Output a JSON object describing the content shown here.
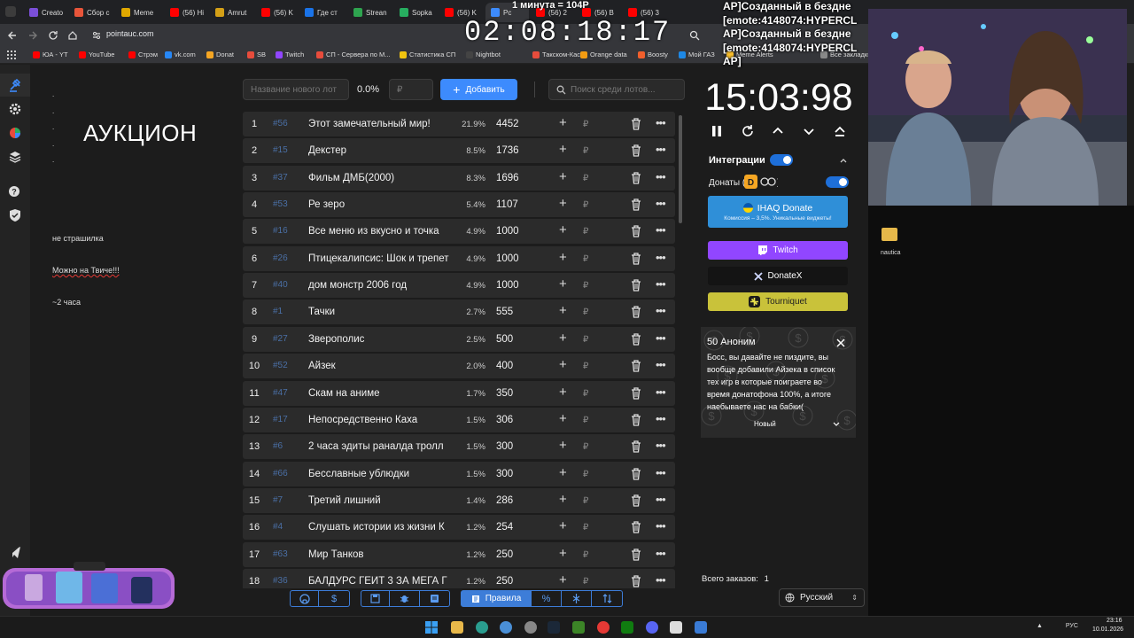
{
  "browser": {
    "tabs": [
      {
        "label": "Creato",
        "color": "#7b4fd8"
      },
      {
        "label": "Сбор с",
        "color": "#e8553a"
      },
      {
        "label": "Meme",
        "color": "#e0a800"
      },
      {
        "label": "(56) Hi",
        "color": "#ff0000"
      },
      {
        "label": "Amrut",
        "color": "#d4a017"
      },
      {
        "label": "(56) K",
        "color": "#ff0000"
      },
      {
        "label": "Где ст",
        "color": "#1a73e8"
      },
      {
        "label": "Strean",
        "color": "#2ea44f"
      },
      {
        "label": "Sopka",
        "color": "#27ae60"
      },
      {
        "label": "(56) K",
        "color": "#ff0000"
      },
      {
        "label": "Рс",
        "color": "#3d8bfd"
      },
      {
        "label": "(56) 2",
        "color": "#ff0000"
      },
      {
        "label": "(56) B",
        "color": "#ff0000"
      },
      {
        "label": "(56) 3",
        "color": "#ff0000"
      }
    ],
    "url": "pointauc.com",
    "bookmarks": [
      {
        "label": "ЮА - YT",
        "color": "#ff0000"
      },
      {
        "label": "YouTube",
        "color": "#ff0000"
      },
      {
        "label": "Стрэм",
        "color": "#ff0000"
      },
      {
        "label": "vk.com",
        "color": "#2787f5"
      },
      {
        "label": "Donat",
        "color": "#f5a623"
      },
      {
        "label": "SB",
        "color": "#e74c3c"
      },
      {
        "label": "Twitch",
        "color": "#9146ff"
      },
      {
        "label": "СП - Сервера по М...",
        "color": "#e74c3c"
      },
      {
        "label": "Статистика СП",
        "color": "#f1c40f"
      },
      {
        "label": "Nightbot",
        "color": "#444"
      },
      {
        "label": "Такском-Касса",
        "color": "#e74c3c"
      },
      {
        "label": "Orange data",
        "color": "#f39c12"
      },
      {
        "label": "Boosty",
        "color": "#f15f2c"
      },
      {
        "label": "Мой ГАЗ",
        "color": "#1e88e5"
      },
      {
        "label": "Meme Alerts",
        "color": "#fbc02d"
      },
      {
        "label": "Все закладки",
        "color": "#888"
      }
    ]
  },
  "sidebar": {
    "title": "АУКЦИОН",
    "bullets": [
      ".",
      ".",
      ".",
      ".",
      ".",
      "."
    ],
    "notes": [
      "не страшилка",
      "Можно на  Твиче!!!",
      "~2 часа"
    ]
  },
  "controls": {
    "new_lot_placeholder": "Название нового лот",
    "percent": "0.0%",
    "amount_placeholder": "₽",
    "add_label": "Добавить",
    "search_placeholder": "Поиск среди лотов..."
  },
  "lots": [
    {
      "num": "1",
      "fast": "#56",
      "name": "Этот замечательный мир!",
      "pct": "21.9%",
      "amount": "4452"
    },
    {
      "num": "2",
      "fast": "#15",
      "name": "Декстер",
      "pct": "8.5%",
      "amount": "1736"
    },
    {
      "num": "3",
      "fast": "#37",
      "name": "Фильм ДМБ(2000)",
      "pct": "8.3%",
      "amount": "1696"
    },
    {
      "num": "4",
      "fast": "#53",
      "name": "Ре зеро",
      "pct": "5.4%",
      "amount": "1107"
    },
    {
      "num": "5",
      "fast": "#16",
      "name": "Все меню из вкусно и точка",
      "pct": "4.9%",
      "amount": "1000"
    },
    {
      "num": "6",
      "fast": "#26",
      "name": "Птицекалипсис: Шок и трепет",
      "pct": "4.9%",
      "amount": "1000"
    },
    {
      "num": "7",
      "fast": "#40",
      "name": "дом монстр 2006 год",
      "pct": "4.9%",
      "amount": "1000"
    },
    {
      "num": "8",
      "fast": "#1",
      "name": "Тачки",
      "pct": "2.7%",
      "amount": "555"
    },
    {
      "num": "9",
      "fast": "#27",
      "name": "Зверополис",
      "pct": "2.5%",
      "amount": "500"
    },
    {
      "num": "10",
      "fast": "#52",
      "name": "Айзек",
      "pct": "2.0%",
      "amount": "400"
    },
    {
      "num": "11",
      "fast": "#47",
      "name": "Скам на аниме",
      "pct": "1.7%",
      "amount": "350"
    },
    {
      "num": "12",
      "fast": "#17",
      "name": "Непосредственно Каха",
      "pct": "1.5%",
      "amount": "306"
    },
    {
      "num": "13",
      "fast": "#6",
      "name": "2 часа эдиты раналда тролл",
      "pct": "1.5%",
      "amount": "300"
    },
    {
      "num": "14",
      "fast": "#66",
      "name": "Бесславные ублюдки",
      "pct": "1.5%",
      "amount": "300"
    },
    {
      "num": "15",
      "fast": "#7",
      "name": "Третий лишний",
      "pct": "1.4%",
      "amount": "286"
    },
    {
      "num": "16",
      "fast": "#4",
      "name": "Слушать истории из жизни К",
      "pct": "1.2%",
      "amount": "254"
    },
    {
      "num": "17",
      "fast": "#63",
      "name": "Мир Танков",
      "pct": "1.2%",
      "amount": "250"
    },
    {
      "num": "18",
      "fast": "#36",
      "name": "БАЛДУРС ГЕЙТ 3 ЗА МЕГА Г",
      "pct": "1.2%",
      "amount": "250"
    }
  ],
  "currency": "₽",
  "timer": {
    "value": "15:03:98"
  },
  "integrations": {
    "label": "Интеграции",
    "donations_label": "Донаты (",
    "ihaq_label": "IHAQ Donate",
    "ihaq_sub": "Комиссия – 3,5%. Уникальные виджеты!",
    "twitch_label": "Twitch",
    "donatex_label": "DonateX",
    "tourniquet_label": "Tourniquet",
    "colors": {
      "ihaq": "#2f8fd8",
      "twitch": "#9146ff",
      "donatex": "#141414",
      "tourniquet": "#c9c23a"
    }
  },
  "alert": {
    "name": "50 Аноним",
    "message": "Босс, вы давайте не пиздите, вы вообще добавили Айзека в список тех игр в которые поиграете во время донатофона 100%, а итоге наебываете нас на бабки(",
    "status": "Новый"
  },
  "orders": {
    "label": "Всего заказов:",
    "count": "1"
  },
  "language": "Русский",
  "bottom_toolbar": {
    "rules_label": "Правила",
    "percent_label": "%"
  },
  "overlay": {
    "top_text": "1 минута = 104Р",
    "clock": "02:08:18:17",
    "chat_lines": [
      "AP]Созданный в бездне",
      "[emote:4148074:HYPERCL",
      "AP]Созданный в бездне",
      "[emote:4148074:HYPERCL",
      "AP]"
    ],
    "desktop_item": "nautica"
  },
  "taskbar": {
    "lang": "РУС",
    "time": "23:16",
    "date": "10.01.2026"
  }
}
